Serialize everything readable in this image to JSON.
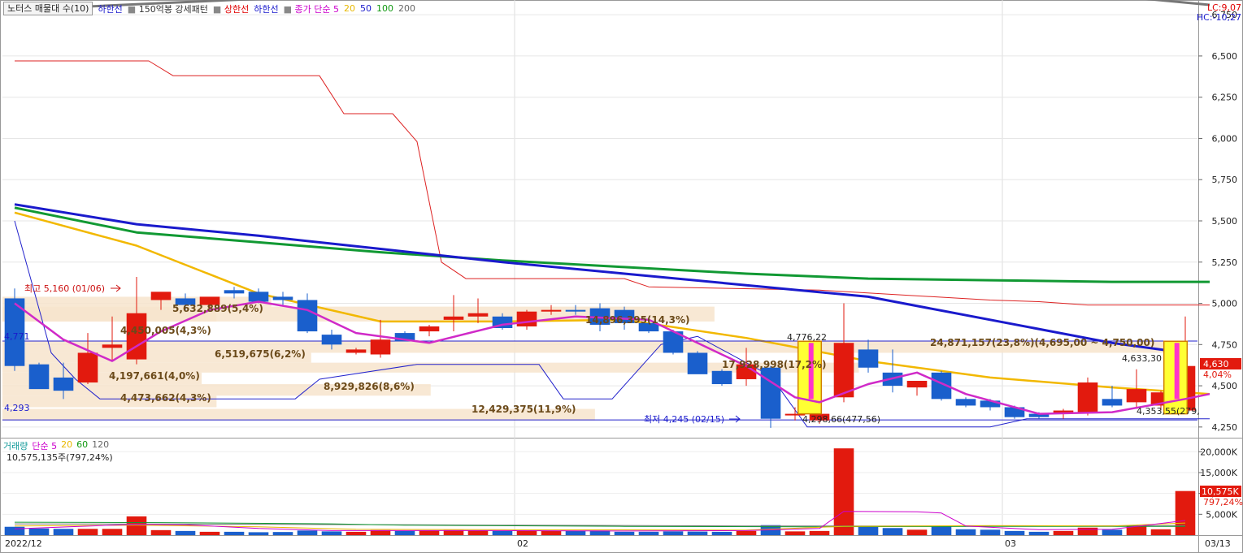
{
  "header": {
    "title": "노터스 매물대 수(10)",
    "items": [
      {
        "label": "하한선",
        "color": "#1a1acc"
      },
      {
        "label": "150억봉 강세패턴",
        "color": "#333333"
      },
      {
        "label": "상한선",
        "color": "#e00000"
      },
      {
        "label": "하한선",
        "color": "#1a1acc"
      },
      {
        "label": "종가 단순 5",
        "color": "#cc00cc"
      },
      {
        "label": "20",
        "color": "#e8b800"
      },
      {
        "label": "50",
        "color": "#1a1acc"
      },
      {
        "label": "100",
        "color": "#119911"
      },
      {
        "label": "200",
        "color": "#666666"
      }
    ],
    "lc": "LC:9,07",
    "hc": "HC:-10,27"
  },
  "volume_header": {
    "items": [
      {
        "label": "거래량",
        "color": "#119999"
      },
      {
        "label": "단순 5",
        "color": "#cc00cc"
      },
      {
        "label": "20",
        "color": "#e8b800"
      },
      {
        "label": "60",
        "color": "#119911"
      },
      {
        "label": "120",
        "color": "#666666"
      }
    ],
    "sub": "10,575,135주(797,24%)"
  },
  "chart_data": {
    "type": "candlestick",
    "price_axis": {
      "ticks": [
        "6,750",
        "6,500",
        "6,250",
        "6,000",
        "5,750",
        "5,500",
        "5,250",
        "5,000",
        "4,750",
        "4,500",
        "4,250"
      ],
      "min": 4200,
      "max": 6800
    },
    "volume_axis": {
      "ticks": [
        "20,000K",
        "15,000K",
        "10,000K",
        "5,000K"
      ],
      "max": 22000
    },
    "date_labels": [
      {
        "label": "2022/12",
        "index": 0
      },
      {
        "label": "02",
        "index": 21
      },
      {
        "label": "03",
        "index": 41
      },
      {
        "label": "03/13",
        "index": 50
      }
    ],
    "candles": [
      {
        "o": 5030,
        "h": 5090,
        "l": 4590,
        "c": 4620
      },
      {
        "o": 4630,
        "h": 4640,
        "l": 4490,
        "c": 4480
      },
      {
        "o": 4550,
        "h": 4640,
        "l": 4420,
        "c": 4470
      },
      {
        "o": 4520,
        "h": 4820,
        "l": 4510,
        "c": 4700
      },
      {
        "o": 4730,
        "h": 4920,
        "l": 4650,
        "c": 4750
      },
      {
        "o": 4660,
        "h": 5160,
        "l": 4630,
        "c": 4940
      },
      {
        "o": 5020,
        "h": 5040,
        "l": 4960,
        "c": 5070
      },
      {
        "o": 5030,
        "h": 5060,
        "l": 4950,
        "c": 4990
      },
      {
        "o": 4990,
        "h": 5030,
        "l": 4960,
        "c": 5040
      },
      {
        "o": 5080,
        "h": 5100,
        "l": 5030,
        "c": 5060
      },
      {
        "o": 5070,
        "h": 5090,
        "l": 5000,
        "c": 5010
      },
      {
        "o": 5040,
        "h": 5070,
        "l": 4990,
        "c": 5020
      },
      {
        "o": 5020,
        "h": 5060,
        "l": 4820,
        "c": 4830
      },
      {
        "o": 4810,
        "h": 4840,
        "l": 4720,
        "c": 4750
      },
      {
        "o": 4700,
        "h": 4730,
        "l": 4690,
        "c": 4720
      },
      {
        "o": 4690,
        "h": 4900,
        "l": 4670,
        "c": 4780
      },
      {
        "o": 4820,
        "h": 4830,
        "l": 4780,
        "c": 4770
      },
      {
        "o": 4830,
        "h": 4870,
        "l": 4800,
        "c": 4860
      },
      {
        "o": 4900,
        "h": 5050,
        "l": 4830,
        "c": 4920
      },
      {
        "o": 4920,
        "h": 5030,
        "l": 4880,
        "c": 4940
      },
      {
        "o": 4920,
        "h": 4940,
        "l": 4840,
        "c": 4850
      },
      {
        "o": 4860,
        "h": 4960,
        "l": 4840,
        "c": 4950
      },
      {
        "o": 4950,
        "h": 4990,
        "l": 4930,
        "c": 4960
      },
      {
        "o": 4960,
        "h": 4990,
        "l": 4930,
        "c": 4950
      },
      {
        "o": 4970,
        "h": 5000,
        "l": 4830,
        "c": 4870
      },
      {
        "o": 4960,
        "h": 4980,
        "l": 4840,
        "c": 4880
      },
      {
        "o": 4880,
        "h": 4900,
        "l": 4820,
        "c": 4830
      },
      {
        "o": 4830,
        "h": 4840,
        "l": 4690,
        "c": 4700
      },
      {
        "o": 4700,
        "h": 4710,
        "l": 4580,
        "c": 4570
      },
      {
        "o": 4590,
        "h": 4600,
        "l": 4500,
        "c": 4510
      },
      {
        "o": 4540,
        "h": 4730,
        "l": 4500,
        "c": 4630
      },
      {
        "o": 4610,
        "h": 4620,
        "l": 4245,
        "c": 4300
      },
      {
        "o": 4330,
        "h": 4370,
        "l": 4290,
        "c": 4330
      },
      {
        "o": 4290,
        "h": 4340,
        "l": 4270,
        "c": 4330
      },
      {
        "o": 4430,
        "h": 5000,
        "l": 4400,
        "c": 4760
      },
      {
        "o": 4720,
        "h": 4780,
        "l": 4580,
        "c": 4610
      },
      {
        "o": 4580,
        "h": 4720,
        "l": 4460,
        "c": 4500
      },
      {
        "o": 4490,
        "h": 4520,
        "l": 4440,
        "c": 4530
      },
      {
        "o": 4580,
        "h": 4590,
        "l": 4410,
        "c": 4420
      },
      {
        "o": 4420,
        "h": 4430,
        "l": 4370,
        "c": 4380
      },
      {
        "o": 4410,
        "h": 4420,
        "l": 4350,
        "c": 4370
      },
      {
        "o": 4370,
        "h": 4380,
        "l": 4300,
        "c": 4310
      },
      {
        "o": 4330,
        "h": 4340,
        "l": 4300,
        "c": 4310
      },
      {
        "o": 4330,
        "h": 4360,
        "l": 4300,
        "c": 4350
      },
      {
        "o": 4340,
        "h": 4550,
        "l": 4320,
        "c": 4520
      },
      {
        "o": 4420,
        "h": 4500,
        "l": 4370,
        "c": 4380
      },
      {
        "o": 4400,
        "h": 4600,
        "l": 4360,
        "c": 4480
      },
      {
        "o": 4380,
        "h": 4470,
        "l": 4350,
        "c": 4460
      },
      {
        "o": 4350,
        "h": 4920,
        "l": 4340,
        "c": 4620
      }
    ],
    "volume": [
      2000,
      1600,
      1500,
      1500,
      1500,
      4500,
      1200,
      1000,
      800,
      800,
      700,
      750,
      1100,
      900,
      800,
      1200,
      1000,
      1100,
      1200,
      1100,
      1000,
      1100,
      1000,
      1000,
      1100,
      800,
      800,
      900,
      850,
      800,
      1000,
      2400,
      900,
      1000,
      20800,
      2000,
      1700,
      1300,
      2100,
      1400,
      1300,
      1000,
      800,
      1000,
      1800,
      1300,
      2300,
      1400,
      10575
    ],
    "ma5_points": [
      [
        0,
        5000
      ],
      [
        2,
        4780
      ],
      [
        4,
        4650
      ],
      [
        6,
        4830
      ],
      [
        8,
        4960
      ],
      [
        10,
        5010
      ],
      [
        12,
        4960
      ],
      [
        14,
        4820
      ],
      [
        17,
        4760
      ],
      [
        20,
        4870
      ],
      [
        23,
        4920
      ],
      [
        26,
        4900
      ],
      [
        28,
        4760
      ],
      [
        30,
        4620
      ],
      [
        32,
        4430
      ],
      [
        33,
        4400
      ],
      [
        35,
        4510
      ],
      [
        37,
        4580
      ],
      [
        39,
        4450
      ],
      [
        42,
        4330
      ],
      [
        45,
        4340
      ],
      [
        48,
        4420
      ],
      [
        49,
        4450
      ]
    ],
    "ma20_points": [
      [
        0,
        5550
      ],
      [
        5,
        5350
      ],
      [
        10,
        5060
      ],
      [
        15,
        4890
      ],
      [
        20,
        4890
      ],
      [
        25,
        4900
      ],
      [
        30,
        4790
      ],
      [
        35,
        4650
      ],
      [
        40,
        4550
      ],
      [
        45,
        4490
      ],
      [
        49,
        4450
      ]
    ],
    "ma50_points": [
      [
        0,
        5600
      ],
      [
        5,
        5480
      ],
      [
        10,
        5410
      ],
      [
        15,
        5330
      ],
      [
        20,
        5250
      ],
      [
        25,
        5180
      ],
      [
        30,
        5110
      ],
      [
        35,
        5040
      ],
      [
        40,
        4900
      ],
      [
        45,
        4760
      ],
      [
        48,
        4700
      ]
    ],
    "ma100_points": [
      [
        0,
        5580
      ],
      [
        5,
        5430
      ],
      [
        10,
        5370
      ],
      [
        15,
        5310
      ],
      [
        20,
        5260
      ],
      [
        25,
        5220
      ],
      [
        30,
        5180
      ],
      [
        35,
        5150
      ],
      [
        40,
        5140
      ],
      [
        45,
        5130
      ],
      [
        49,
        5130
      ]
    ],
    "ma200_points": [
      [
        0,
        6780
      ],
      [
        6,
        6820
      ],
      [
        12,
        6860
      ],
      [
        18,
        6890
      ],
      [
        24,
        6910
      ],
      [
        30,
        6920
      ],
      [
        38,
        6920
      ],
      [
        44,
        6880
      ],
      [
        49,
        6810
      ]
    ],
    "upper_band": [
      [
        0,
        6470
      ],
      [
        5.5,
        6470
      ],
      [
        6.5,
        6380
      ],
      [
        12.5,
        6380
      ],
      [
        13.5,
        6150
      ],
      [
        15.5,
        6150
      ],
      [
        16.5,
        5980
      ],
      [
        17.5,
        5250
      ],
      [
        18.5,
        5150
      ],
      [
        22,
        5150
      ],
      [
        25,
        5150
      ],
      [
        26,
        5100
      ],
      [
        33,
        5080
      ],
      [
        40,
        5020
      ],
      [
        42,
        5010
      ],
      [
        44,
        4990
      ],
      [
        49,
        4990
      ]
    ],
    "lower_band": [
      [
        0,
        5500
      ],
      [
        1.5,
        4700
      ],
      [
        2.5,
        4540
      ],
      [
        3.5,
        4420
      ],
      [
        11.5,
        4420
      ],
      [
        12.5,
        4540
      ],
      [
        16.5,
        4630
      ],
      [
        21.5,
        4630
      ],
      [
        22.5,
        4420
      ],
      [
        24.5,
        4420
      ],
      [
        26.5,
        4750
      ],
      [
        28,
        4800
      ],
      [
        31,
        4560
      ],
      [
        32.5,
        4250
      ],
      [
        40,
        4250
      ],
      [
        41.5,
        4300
      ],
      [
        49,
        4300
      ]
    ],
    "volume_ma5": [
      [
        0,
        1500
      ],
      [
        5,
        2600
      ],
      [
        7,
        2500
      ],
      [
        10,
        1600
      ],
      [
        13,
        1100
      ],
      [
        20,
        1100
      ],
      [
        25,
        1000
      ],
      [
        30,
        1100
      ],
      [
        33,
        1600
      ],
      [
        34,
        5700
      ],
      [
        37,
        5600
      ],
      [
        38,
        5300
      ],
      [
        39,
        2200
      ],
      [
        42,
        1300
      ],
      [
        45,
        1400
      ],
      [
        48,
        3500
      ]
    ],
    "volume_ma20": [
      [
        0,
        2200
      ],
      [
        5,
        2400
      ],
      [
        10,
        2000
      ],
      [
        14,
        1400
      ],
      [
        20,
        1300
      ],
      [
        30,
        1200
      ],
      [
        34,
        2100
      ],
      [
        40,
        2300
      ],
      [
        45,
        2200
      ],
      [
        48,
        2900
      ]
    ],
    "volume_ma60": [
      [
        0,
        3100
      ],
      [
        6,
        3000
      ],
      [
        13,
        2700
      ],
      [
        16,
        2400
      ],
      [
        25,
        2100
      ],
      [
        33,
        2000
      ],
      [
        40,
        2100
      ],
      [
        48,
        2100
      ]
    ],
    "volume_ma120": [
      [
        0,
        2700
      ],
      [
        10,
        2600
      ],
      [
        20,
        2400
      ],
      [
        30,
        2200
      ],
      [
        40,
        2200
      ],
      [
        48,
        2300
      ]
    ],
    "volume_profile": [
      {
        "label": "5,632,889(5,4%)",
        "lo": 4980,
        "hi": 5040
      },
      {
        "label": "4,450,005(4,3%)",
        "lo": 4890,
        "hi": 4980
      },
      {
        "label": "14,896,395(14,3%)",
        "lo": 4890,
        "hi": 4980
      },
      {
        "label": "24,871,157(23,8%)(4,695,00 ~ 4,750,00)",
        "lo": 4700,
        "hi": 4770
      },
      {
        "label": "6,519,675(6,2%)",
        "lo": 4640,
        "hi": 4700
      },
      {
        "label": "17,928,998(17,2%)",
        "lo": 4580,
        "hi": 4640
      },
      {
        "label": "4,197,661(4,0%)",
        "lo": 4510,
        "hi": 4580
      },
      {
        "label": "8,929,826(8,6%)",
        "lo": 4440,
        "hi": 4510
      },
      {
        "label": "4,473,662(4,3%)",
        "lo": 4370,
        "hi": 4440
      },
      {
        "label": "12,429,375(11,9%)",
        "lo": 4290,
        "hi": 4360
      }
    ],
    "annotations": {
      "high_label": "최고 5,160 (01/06)",
      "low_label": "최저 4,245 (02/15)",
      "mark_4771": "4,771",
      "mark_4293": "4,293",
      "mark_477622": "4,776,22",
      "mark_429866": "4,298,66(477,56)",
      "mark_463330": "4,633,30",
      "mark_435355": "4,353,55(279,",
      "current_price": "4,630",
      "current_pct": "4,04%",
      "current_volume": "10,575K",
      "current_volume_pct": "797,24%"
    }
  }
}
